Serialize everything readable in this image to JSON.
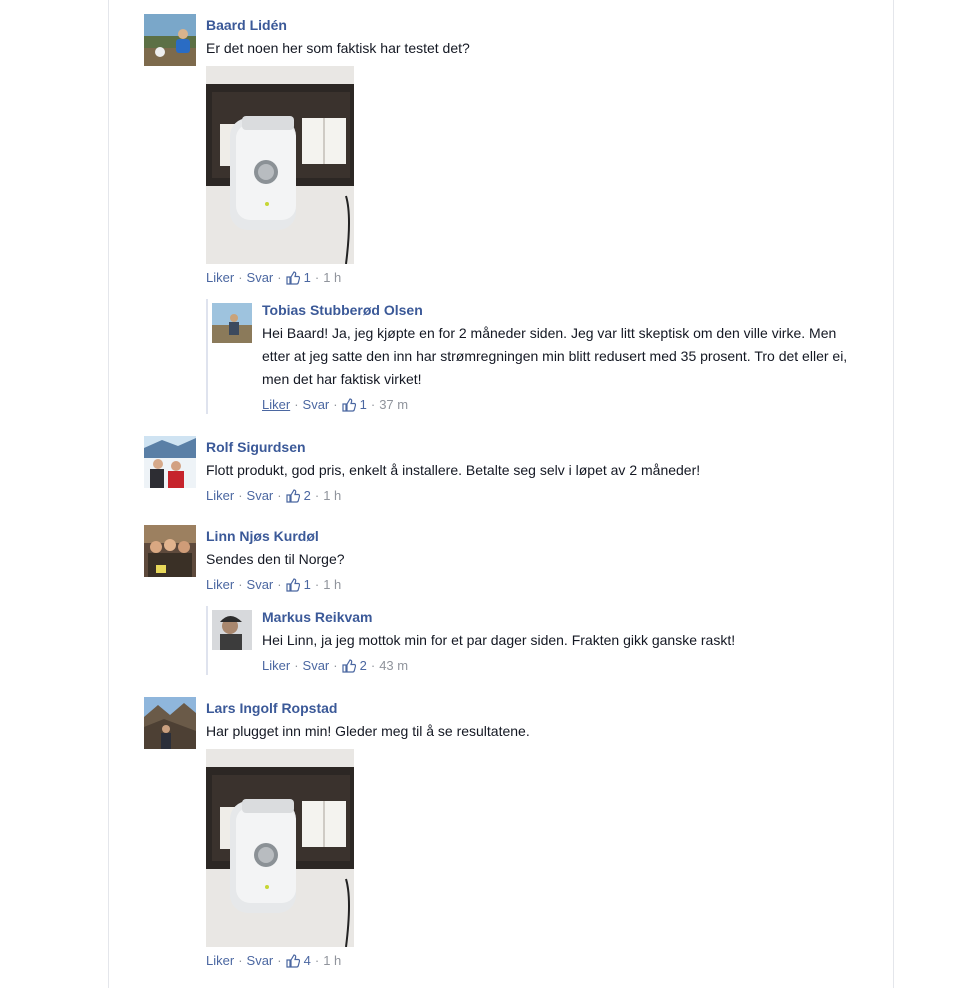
{
  "comments": [
    {
      "author": "Baard Lidén",
      "text": "Er det noen her som faktisk har testet det?",
      "has_photo": true,
      "like_label": "Liker",
      "reply_label": "Svar",
      "likes": "1",
      "time": "1 h",
      "replies": [
        {
          "author": "Tobias Stubberød Olsen",
          "text": "Hei Baard! Ja, jeg kjøpte en for 2 måneder siden. Jeg var litt skeptisk om den ville virke. Men etter at jeg satte den inn har strømregningen min blitt redusert med 35 prosent. Tro det eller ei, men det har faktisk virket!",
          "like_label": "Liker",
          "reply_label": "Svar",
          "likes": "1",
          "time": "37 m"
        }
      ]
    },
    {
      "author": "Rolf Sigurdsen",
      "text": "Flott produkt, god pris, enkelt å installere. Betalte seg selv i løpet av 2 måneder!",
      "like_label": "Liker",
      "reply_label": "Svar",
      "likes": "2",
      "time": "1 h"
    },
    {
      "author": "Linn Njøs Kurdøl",
      "text": "Sendes den til Norge?",
      "like_label": "Liker",
      "reply_label": "Svar",
      "likes": "1",
      "time": "1 h",
      "replies": [
        {
          "author": "Markus Reikvam",
          "text": "Hei Linn, ja jeg mottok min for et par dager siden. Frakten gikk ganske raskt!",
          "like_label": "Liker",
          "reply_label": "Svar",
          "likes": "2",
          "time": "43 m"
        }
      ]
    },
    {
      "author": "Lars Ingolf Ropstad",
      "text": "Har plugget inn min! Gleder meg til å se resultatene.",
      "has_photo": true,
      "like_label": "Liker",
      "reply_label": "Svar",
      "likes": "4",
      "time": "1 h"
    }
  ],
  "colors": {
    "author_link": "#3b5998",
    "action_link": "#4b67a1",
    "meta_grey": "#90949c",
    "text": "#141823"
  },
  "icons": {
    "like": "thumbs-up-icon"
  }
}
